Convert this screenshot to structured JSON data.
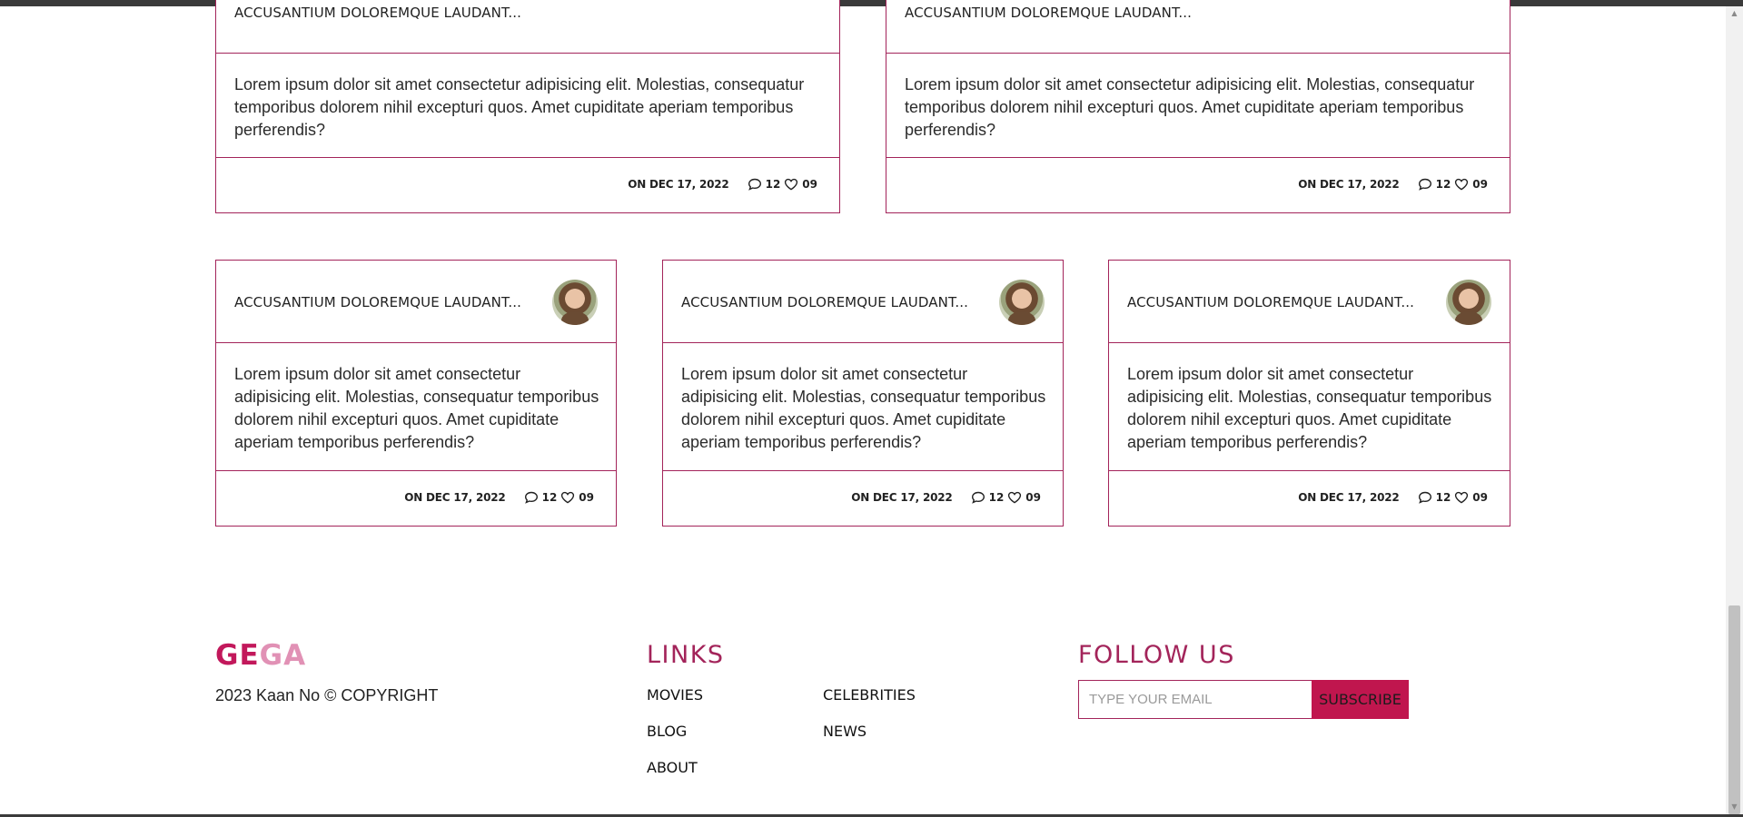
{
  "posts_top": [
    {
      "title": "ACCUSANTIUM DOLOREMQUE LAUDANT...",
      "body": "Lorem ipsum dolor sit amet consectetur adipisicing elit. Molestias, consequatur temporibus dolorem nihil excepturi quos. Amet cupiditate aperiam temporibus perferendis?",
      "date": "ON DEC 17, 2022",
      "comments": "12",
      "likes": "09"
    },
    {
      "title": "ACCUSANTIUM DOLOREMQUE LAUDANT...",
      "body": "Lorem ipsum dolor sit amet consectetur adipisicing elit. Molestias, consequatur temporibus dolorem nihil excepturi quos. Amet cupiditate aperiam temporibus perferendis?",
      "date": "ON DEC 17, 2022",
      "comments": "12",
      "likes": "09"
    }
  ],
  "posts_bottom": [
    {
      "title": "ACCUSANTIUM DOLOREMQUE LAUDANT...",
      "body": "Lorem ipsum dolor sit amet consectetur adipisicing elit. Molestias, consequatur temporibus dolorem nihil excepturi quos. Amet cupiditate aperiam temporibus perferendis?",
      "date": "ON DEC 17, 2022",
      "comments": "12",
      "likes": "09"
    },
    {
      "title": "ACCUSANTIUM DOLOREMQUE LAUDANT...",
      "body": "Lorem ipsum dolor sit amet consectetur adipisicing elit. Molestias, consequatur temporibus dolorem nihil excepturi quos. Amet cupiditate aperiam temporibus perferendis?",
      "date": "ON DEC 17, 2022",
      "comments": "12",
      "likes": "09"
    },
    {
      "title": "ACCUSANTIUM DOLOREMQUE LAUDANT...",
      "body": "Lorem ipsum dolor sit amet consectetur adipisicing elit. Molestias, consequatur temporibus dolorem nihil excepturi quos. Amet cupiditate aperiam temporibus perferendis?",
      "date": "ON DEC 17, 2022",
      "comments": "12",
      "likes": "09"
    }
  ],
  "footer": {
    "logo_part1": "GE",
    "logo_part2": "GA",
    "copyright": "2023 Kaan No © COPYRIGHT",
    "links_heading": "LINKS",
    "links": [
      "MOVIES",
      "CELEBRITIES",
      "BLOG",
      "NEWS",
      "ABOUT"
    ],
    "follow_heading": "FOLLOW US",
    "email_placeholder": "TYPE YOUR EMAIL",
    "subscribe_label": "SUBSCRIBE"
  },
  "colors": {
    "accent": "#a3245a",
    "button": "#c0164e",
    "logo_light": "#e191b5"
  },
  "icons": [
    "comment-icon",
    "heart-icon",
    "avatar-photo"
  ]
}
